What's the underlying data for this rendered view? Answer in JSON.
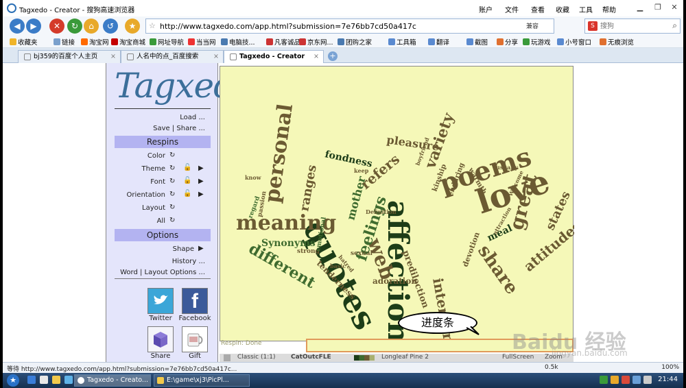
{
  "window": {
    "title": "Tagxedo - Creator - 搜狗高速浏览器",
    "menu": [
      "账户",
      "文件",
      "查看",
      "收藏",
      "工具",
      "帮助"
    ]
  },
  "nav": {
    "url": "http://www.tagxedo.com/app.html?submission=7e76bb7cd50a417c",
    "compat_label": "兼容",
    "search_placeholder": "搜狗"
  },
  "favorites": [
    {
      "label": "收藏夹",
      "color": "#f0b429"
    },
    {
      "label": "链接",
      "color": "#7aa0cc"
    },
    {
      "label": "淘宝网",
      "color": "#ff6a00"
    },
    {
      "label": "淘宝商城",
      "color": "#c40000"
    },
    {
      "label": "网址导航",
      "color": "#3a9a3a"
    },
    {
      "label": "当当网",
      "color": "#e33"
    },
    {
      "label": "电脑技...",
      "color": "#4a7ab0"
    },
    {
      "label": "凡客诚品",
      "color": "#c33"
    },
    {
      "label": "京东网...",
      "color": "#c33"
    },
    {
      "label": "团购之家",
      "color": "#4a7ab0"
    },
    {
      "label": "工具箱",
      "color": "#5a8ad0"
    },
    {
      "label": "翻译",
      "color": "#5a8ad0"
    },
    {
      "label": "截图",
      "color": "#5a8ad0"
    },
    {
      "label": "分享",
      "color": "#e07030"
    },
    {
      "label": "玩游戏",
      "color": "#3a9a3a"
    },
    {
      "label": "小号窗口",
      "color": "#5a8ad0"
    },
    {
      "label": "无痕浏览",
      "color": "#e07030"
    }
  ],
  "tabs": [
    {
      "label": "bj359的百度个人主页"
    },
    {
      "label": "人名中的点_百度搜索"
    },
    {
      "label": "Tagxedo - Creator"
    }
  ],
  "sidebar": {
    "logo": "Tagxedo",
    "load": "Load ...",
    "save_share": "Save | Share ...",
    "respins_header": "Respins",
    "color": "Color",
    "theme": "Theme",
    "font": "Font",
    "orientation": "Orientation",
    "layout": "Layout",
    "all": "All",
    "options_header": "Options",
    "shape": "Shape",
    "history": "History ...",
    "word_layout": "Word | Layout Options ...",
    "twitter": "Twitter",
    "facebook": "Facebook",
    "share": "Share",
    "gift": "Gift"
  },
  "canvas": {
    "status": "Respin: Done",
    "bottom": {
      "classic": "Classic (1:1)",
      "font": "CatOutcFLE",
      "theme": "Longleaf Pine 2",
      "fullscreen": "FullScreen",
      "zoom": "Zoom"
    }
  },
  "wordcloud": [
    {
      "text": "quotes",
      "size": 46,
      "color": "#1d3d18",
      "rot": 62
    },
    {
      "text": "affection",
      "size": 42,
      "color": "#1d3d18",
      "rot": 90
    },
    {
      "text": "love",
      "size": 48,
      "color": "#6b5a32",
      "rot": -18
    },
    {
      "text": "poems",
      "size": 38,
      "color": "#6b5a32",
      "rot": -18
    },
    {
      "text": "meaning",
      "size": 30,
      "color": "#6b5a32",
      "rot": 0
    },
    {
      "text": "personal",
      "size": 30,
      "color": "#6b5a32",
      "rot": -82
    },
    {
      "text": "web",
      "size": 28,
      "color": "#6b5a32",
      "rot": 70
    },
    {
      "text": "feelings",
      "size": 22,
      "color": "#3f6b2f",
      "rot": -72
    },
    {
      "text": "different",
      "size": 22,
      "color": "#3f6b2f",
      "rot": 30
    },
    {
      "text": "great",
      "size": 28,
      "color": "#6b5a32",
      "rot": -75
    },
    {
      "text": "attitudes",
      "size": 20,
      "color": "#6b5a32",
      "rot": -40
    },
    {
      "text": "states",
      "size": 18,
      "color": "#6b5a32",
      "rot": -65
    },
    {
      "text": "share",
      "size": 26,
      "color": "#6b5a32",
      "rot": 55
    },
    {
      "text": "interpersonal",
      "size": 20,
      "color": "#6b5a32",
      "rot": 80
    },
    {
      "text": "variety",
      "size": 22,
      "color": "#6b5a32",
      "rot": -70
    },
    {
      "text": "pleasure",
      "size": 16,
      "color": "#6b5a32",
      "rot": 8
    },
    {
      "text": "fondness",
      "size": 14,
      "color": "#1d3d18",
      "rot": 12
    },
    {
      "text": "refers",
      "size": 20,
      "color": "#6b5a32",
      "rot": -40
    },
    {
      "text": "mother",
      "size": 16,
      "color": "#3f6b2f",
      "rot": -75
    },
    {
      "text": "ranges",
      "size": 18,
      "color": "#6b5a32",
      "rot": -80
    },
    {
      "text": "Synonyms",
      "size": 14,
      "color": "#3f6b2f",
      "rot": 0
    },
    {
      "text": "adoration",
      "size": 12,
      "color": "#6b5a32",
      "rot": 0
    },
    {
      "text": "predilection",
      "size": 13,
      "color": "#6b5a32",
      "rot": 70
    },
    {
      "text": "tenderness",
      "size": 12,
      "color": "#6b5a32",
      "rot": 45
    },
    {
      "text": "meal",
      "size": 14,
      "color": "#1d3d18",
      "rot": -25
    },
    {
      "text": "devotion",
      "size": 11,
      "color": "#6b5a32",
      "rot": -70
    },
    {
      "text": "kinship",
      "size": 10,
      "color": "#6b5a32",
      "rot": -70
    },
    {
      "text": "warmth",
      "size": 10,
      "color": "#6b5a32",
      "rot": 60
    },
    {
      "text": "enduring",
      "size": 10,
      "color": "#6b5a32",
      "rot": -70
    },
    {
      "text": "Welcome",
      "size": 8,
      "color": "#6b5a32",
      "rot": -65
    },
    {
      "text": "passion",
      "size": 9,
      "color": "#6b5a32",
      "rot": -80
    },
    {
      "text": "strong",
      "size": 9,
      "color": "#6b5a32",
      "rot": 0
    },
    {
      "text": "regard",
      "size": 9,
      "color": "#3f6b2f",
      "rot": -70
    },
    {
      "text": "emotional",
      "size": 9,
      "color": "#3f6b2f",
      "rot": -80
    },
    {
      "text": "sexual",
      "size": 9,
      "color": "#6b5a32",
      "rot": 0
    },
    {
      "text": "basic",
      "size": 8,
      "color": "#6b5a32",
      "rot": 0
    },
    {
      "text": "Definition",
      "size": 8,
      "color": "#6b5a32",
      "rot": 0
    },
    {
      "text": "hatred",
      "size": 8,
      "color": "#6b5a32",
      "rot": 50
    },
    {
      "text": "usually",
      "size": 8,
      "color": "#6b5a32",
      "rot": 0
    },
    {
      "text": "boyfriend",
      "size": 8,
      "color": "#6b5a32",
      "rot": -70
    },
    {
      "text": "keep",
      "size": 8,
      "color": "#6b5a32",
      "rot": 0
    },
    {
      "text": "attraction",
      "size": 8,
      "color": "#6b5a32",
      "rot": -60
    },
    {
      "text": "know",
      "size": 8,
      "color": "#6b5a32",
      "rot": 0
    }
  ],
  "annotation": {
    "callout": "进度条"
  },
  "watermark": {
    "text": "Baidu 经验",
    "sub": "jingyan.baidu.com"
  },
  "status": {
    "text": "等待 http://www.tagxedo.com/app.html?submission=7e76bb7cd50a417c...",
    "speed": "0.5k",
    "zoom": "100%"
  },
  "taskbar": {
    "items": [
      {
        "label": "Tagxedo - Creato..."
      },
      {
        "label": "E:\\game\\xj3\\PicPl..."
      }
    ],
    "clock": "21:44"
  }
}
